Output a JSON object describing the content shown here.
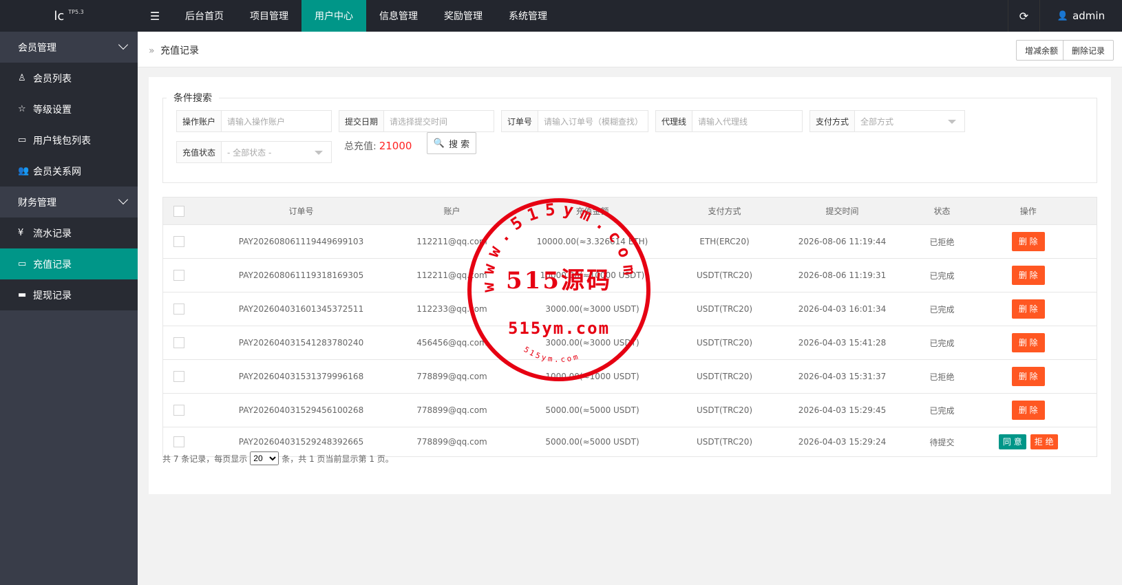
{
  "header": {
    "logo": "lc",
    "logo_version": "TP5.3",
    "menu_icon": "hamburger-icon",
    "nav": [
      "后台首页",
      "项目管理",
      "用户中心",
      "信息管理",
      "奖励管理",
      "系统管理"
    ],
    "active_nav_index": 2,
    "user": "admin"
  },
  "sidebar": {
    "groups": [
      {
        "label": "会员管理",
        "items": [
          {
            "label": "会员列表",
            "icon": "user-icon"
          },
          {
            "label": "等级设置",
            "icon": "star-icon"
          },
          {
            "label": "用户钱包列表",
            "icon": "card-icon"
          },
          {
            "label": "会员关系网",
            "icon": "users-icon"
          }
        ]
      },
      {
        "label": "财务管理",
        "items": [
          {
            "label": "流水记录",
            "icon": "yen-icon"
          },
          {
            "label": "充值记录",
            "icon": "recharge-icon"
          },
          {
            "label": "提现记录",
            "icon": "card-icon"
          }
        ]
      }
    ],
    "active_item": "充值记录"
  },
  "breadcrumb": {
    "current": "充值记录"
  },
  "toolbar": {
    "adjust_balance": "增减余额",
    "delete_records": "删除记录"
  },
  "search": {
    "legend": "条件搜索",
    "fields": {
      "account": {
        "label": "操作账户",
        "placeholder": "请输入操作账户"
      },
      "date": {
        "label": "提交日期",
        "placeholder": "请选择提交时间"
      },
      "order": {
        "label": "订单号",
        "placeholder": "请输入订单号（模糊查找）"
      },
      "agent": {
        "label": "代理线",
        "placeholder": "请输入代理线"
      },
      "pay": {
        "label": "支付方式",
        "value": "全部方式"
      },
      "status": {
        "label": "充值状态",
        "value": "- 全部状态 -"
      }
    },
    "total_label": "总充值:",
    "total_value": "21000",
    "button": "搜 索"
  },
  "table": {
    "columns": [
      "订单号",
      "账户",
      "充值金额",
      "支付方式",
      "提交时间",
      "状态",
      "操作"
    ],
    "rows": [
      {
        "order": "PAY202608061119449699103",
        "account": "112211@qq.com",
        "amount": "10000.00(≈3.326614 ETH)",
        "pay": "ETH(ERC20)",
        "time": "2026-08-06 11:19:44",
        "status": "已拒绝",
        "status_type": "gray",
        "actions": [
          "删 除"
        ]
      },
      {
        "order": "PAY202608061119318169305",
        "account": "112211@qq.com",
        "amount": "10000.00(≈10000 USDT)",
        "pay": "USDT(TRC20)",
        "time": "2026-08-06 11:19:31",
        "status": "已完成",
        "status_type": "green",
        "actions": [
          "删 除"
        ]
      },
      {
        "order": "PAY202604031601345372511",
        "account": "112233@qq.com",
        "amount": "3000.00(≈3000 USDT)",
        "pay": "USDT(TRC20)",
        "time": "2026-04-03 16:01:34",
        "status": "已完成",
        "status_type": "green",
        "actions": [
          "删 除"
        ]
      },
      {
        "order": "PAY202604031541283780240",
        "account": "456456@qq.com",
        "amount": "3000.00(≈3000 USDT)",
        "pay": "USDT(TRC20)",
        "time": "2026-04-03 15:41:28",
        "status": "已完成",
        "status_type": "green",
        "actions": [
          "删 除"
        ]
      },
      {
        "order": "PAY202604031531379996168",
        "account": "778899@qq.com",
        "amount": "1000.00(≈1000 USDT)",
        "pay": "USDT(TRC20)",
        "time": "2026-04-03 15:31:37",
        "status": "已拒绝",
        "status_type": "gray",
        "actions": [
          "删 除"
        ]
      },
      {
        "order": "PAY202604031529456100268",
        "account": "778899@qq.com",
        "amount": "5000.00(≈5000 USDT)",
        "pay": "USDT(TRC20)",
        "time": "2026-04-03 15:29:45",
        "status": "已完成",
        "status_type": "green",
        "actions": [
          "删 除"
        ]
      },
      {
        "order": "PAY202604031529248392665",
        "account": "778899@qq.com",
        "amount": "5000.00(≈5000 USDT)",
        "pay": "USDT(TRC20)",
        "time": "2026-04-03 15:29:24",
        "status": "待提交",
        "status_type": "pend",
        "actions": [
          "同 意",
          "拒 绝"
        ]
      }
    ]
  },
  "pager": {
    "prefix": "共 7 条记录，每页显示",
    "page_size": "20",
    "suffix": "条，共 1 页当前显示第 1 页。"
  },
  "watermark": {
    "ring_text": "www.515ym.com",
    "main": "515源码",
    "sub": "515ym.com",
    "bottom": "515ym.com",
    "color": "#e60012"
  },
  "colors": {
    "accent": "#009688",
    "danger": "#ff5722",
    "sidebar": "#393d49",
    "topbar": "#23262e"
  }
}
